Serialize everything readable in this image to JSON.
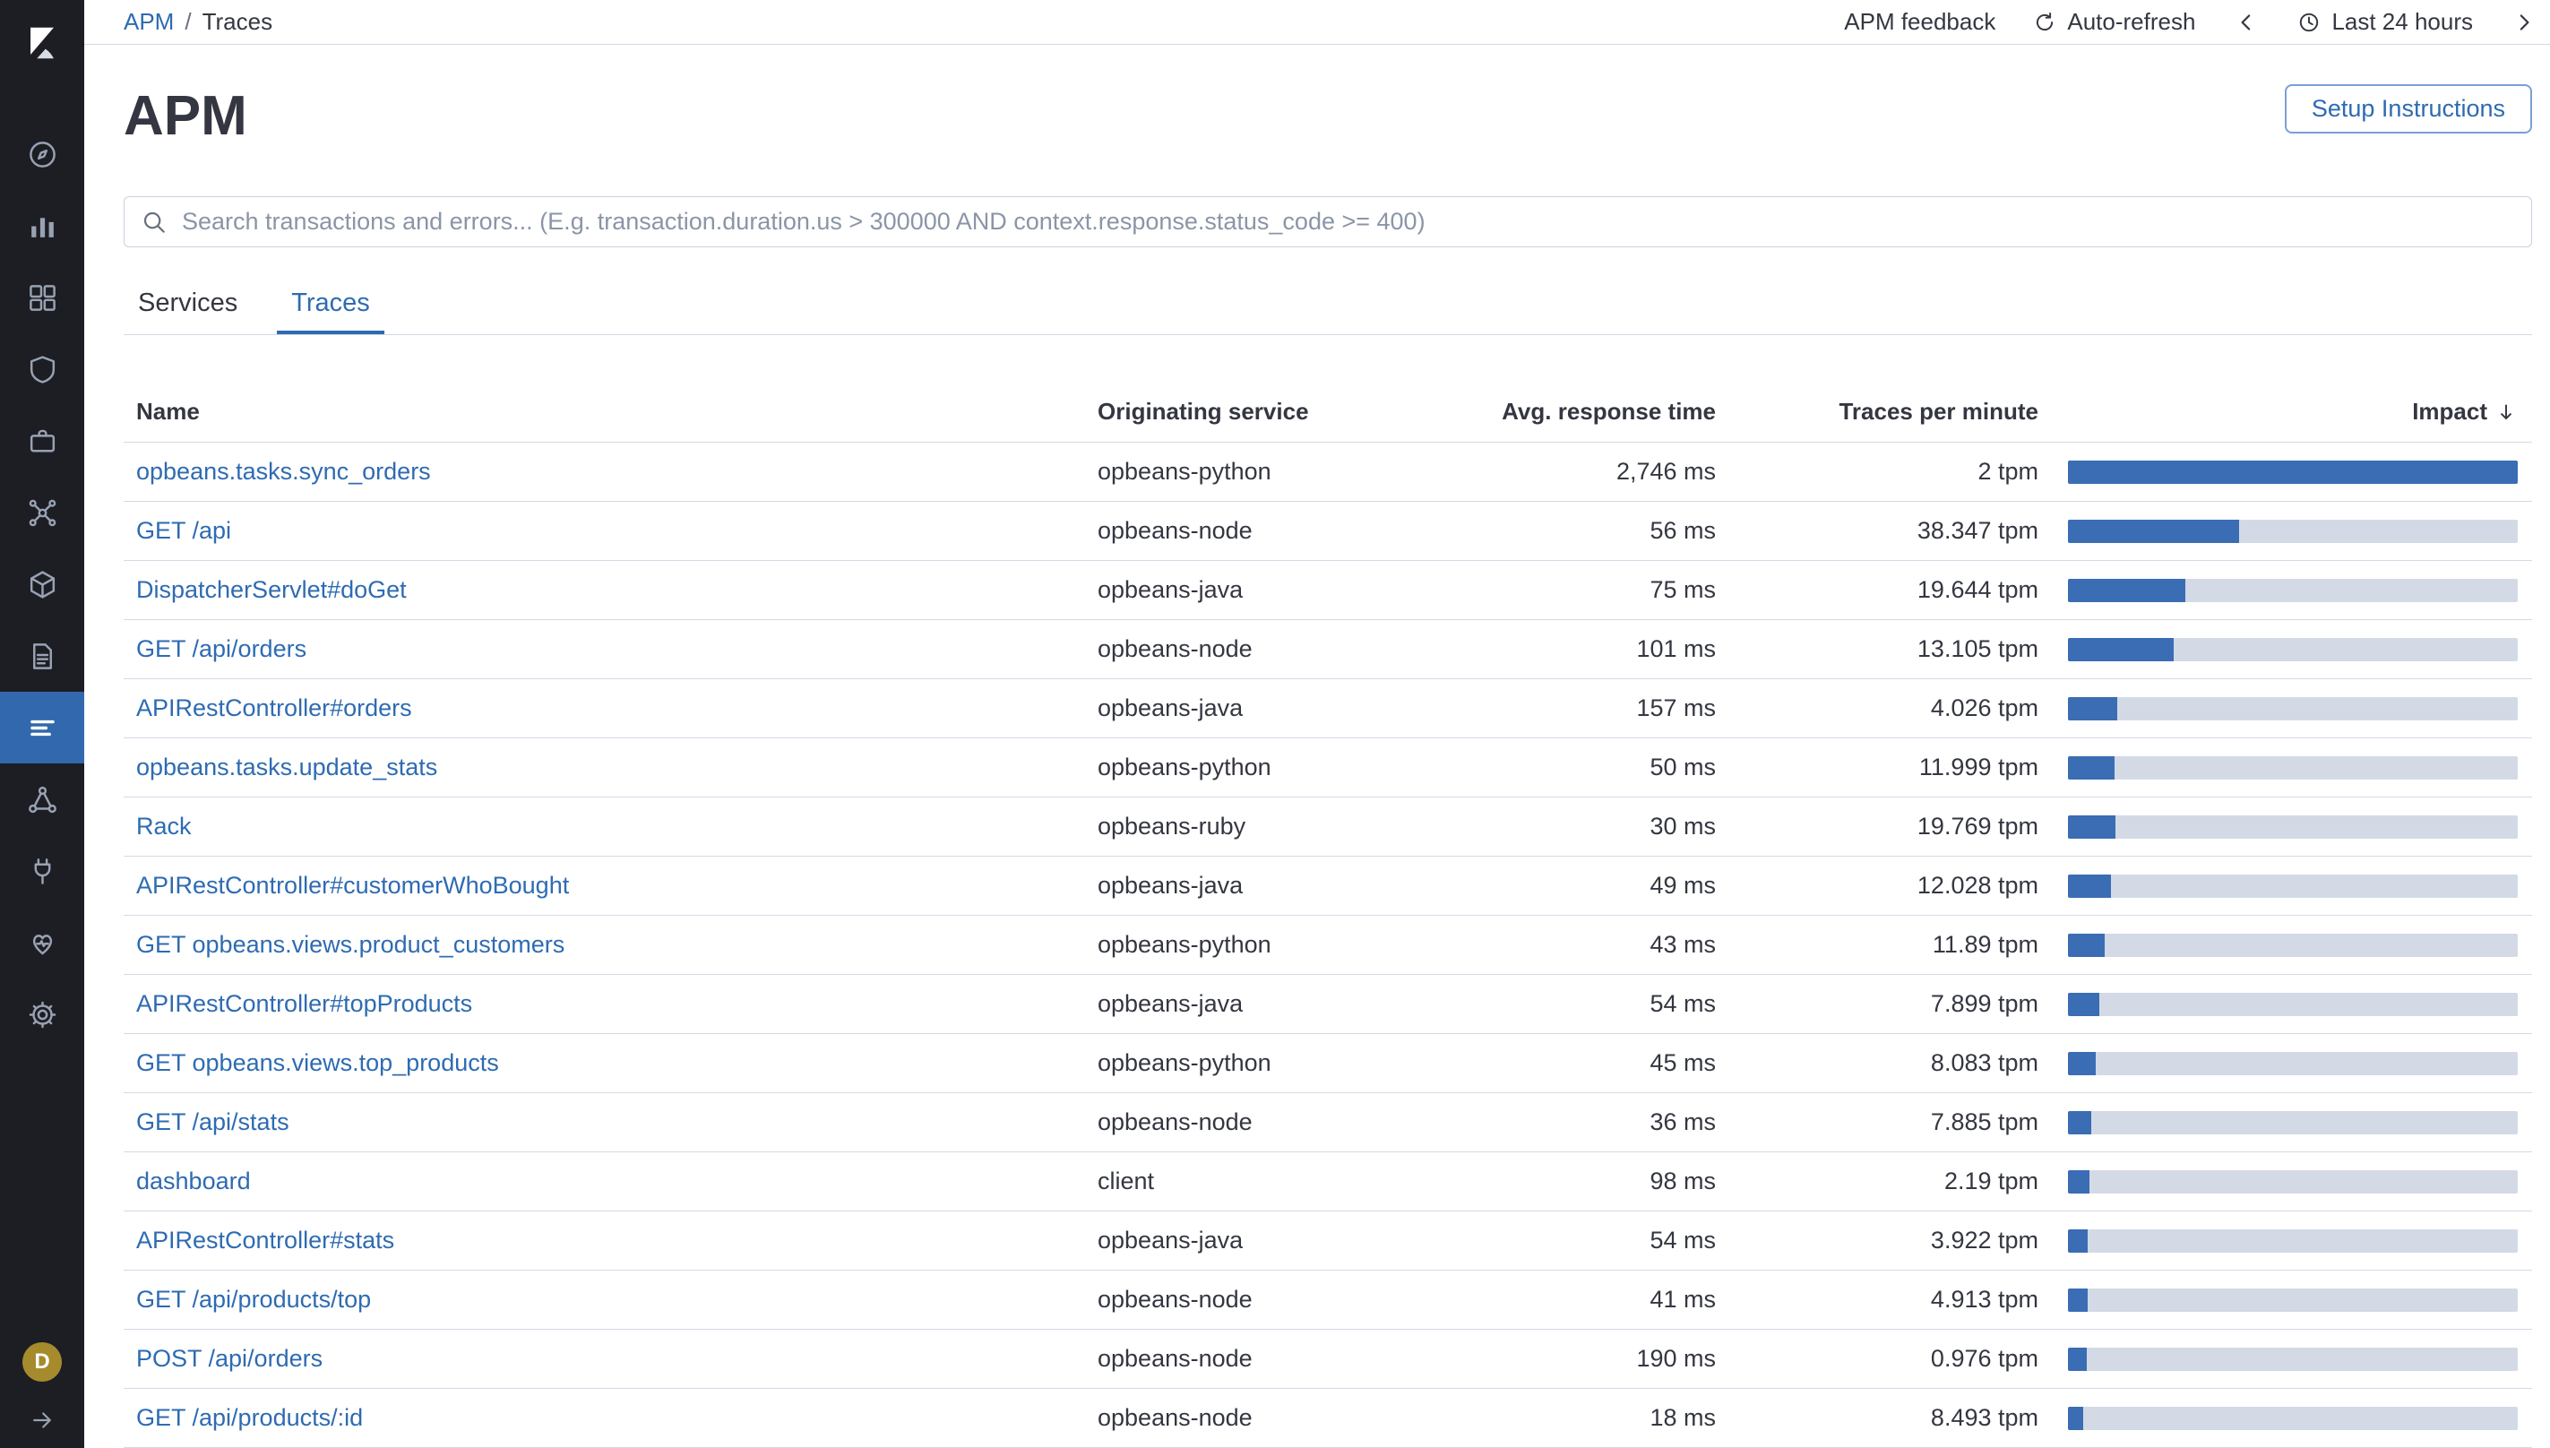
{
  "colors": {
    "accent": "#3a6db3",
    "link": "#2e6bb2",
    "sidebar_background": "#1d1e24",
    "nav_selected": "#3268ad",
    "bar_track": "#d3dae6",
    "border": "#d3dae6",
    "text": "#343741",
    "space_badge": "#a68b2c"
  },
  "sidebar": {
    "space_badge": "D",
    "items": [
      {
        "id": "discover",
        "selected": false
      },
      {
        "id": "visualize",
        "selected": false
      },
      {
        "id": "dashboard",
        "selected": false
      },
      {
        "id": "canvas",
        "selected": false
      },
      {
        "id": "maps",
        "selected": false
      },
      {
        "id": "machine-learning",
        "selected": false
      },
      {
        "id": "infrastructure",
        "selected": false
      },
      {
        "id": "logs",
        "selected": false
      },
      {
        "id": "apm",
        "selected": true
      },
      {
        "id": "graph",
        "selected": false
      },
      {
        "id": "uptime",
        "selected": false
      },
      {
        "id": "monitoring",
        "selected": false
      },
      {
        "id": "management",
        "selected": false
      }
    ]
  },
  "topbar": {
    "breadcrumb": {
      "link": "APM",
      "separator": "/",
      "current": "Traces"
    },
    "feedback_label": "APM feedback",
    "auto_refresh_label": "Auto-refresh",
    "time_range_label": "Last 24 hours"
  },
  "header": {
    "title": "APM",
    "setup_button_label": "Setup Instructions"
  },
  "search": {
    "placeholder": "Search transactions and errors... (E.g. transaction.duration.us > 300000 AND context.response.status_code >= 400)"
  },
  "tabs": [
    {
      "label": "Services",
      "active": false
    },
    {
      "label": "Traces",
      "active": true
    }
  ],
  "table": {
    "columns": [
      "Name",
      "Originating service",
      "Avg. response time",
      "Traces per minute",
      "Impact"
    ],
    "sort": {
      "column": "Impact",
      "direction": "descending"
    },
    "rows": [
      {
        "name": "opbeans.tasks.sync_orders",
        "service": "opbeans-python",
        "response": "2,746 ms",
        "tpm": "2 tpm",
        "impact": 100
      },
      {
        "name": "GET /api",
        "service": "opbeans-node",
        "response": "56 ms",
        "tpm": "38.347 tpm",
        "impact": 38
      },
      {
        "name": "DispatcherServlet#doGet",
        "service": "opbeans-java",
        "response": "75 ms",
        "tpm": "19.644 tpm",
        "impact": 26
      },
      {
        "name": "GET /api/orders",
        "service": "opbeans-node",
        "response": "101 ms",
        "tpm": "13.105 tpm",
        "impact": 23.5
      },
      {
        "name": "APIRestController#orders",
        "service": "opbeans-java",
        "response": "157 ms",
        "tpm": "4.026 tpm",
        "impact": 11
      },
      {
        "name": "opbeans.tasks.update_stats",
        "service": "opbeans-python",
        "response": "50 ms",
        "tpm": "11.999 tpm",
        "impact": 10.3
      },
      {
        "name": "Rack",
        "service": "opbeans-ruby",
        "response": "30 ms",
        "tpm": "19.769 tpm",
        "impact": 10.6
      },
      {
        "name": "APIRestController#customerWhoBought",
        "service": "opbeans-java",
        "response": "49 ms",
        "tpm": "12.028 tpm",
        "impact": 9.6
      },
      {
        "name": "GET opbeans.views.product_customers",
        "service": "opbeans-python",
        "response": "43 ms",
        "tpm": "11.89 tpm",
        "impact": 8.2
      },
      {
        "name": "APIRestController#topProducts",
        "service": "opbeans-java",
        "response": "54 ms",
        "tpm": "7.899 tpm",
        "impact": 7
      },
      {
        "name": "GET opbeans.views.top_products",
        "service": "opbeans-python",
        "response": "45 ms",
        "tpm": "8.083 tpm",
        "impact": 6.2
      },
      {
        "name": "GET /api/stats",
        "service": "opbeans-node",
        "response": "36 ms",
        "tpm": "7.885 tpm",
        "impact": 5.2
      },
      {
        "name": "dashboard",
        "service": "client",
        "response": "98 ms",
        "tpm": "2.19 tpm",
        "impact": 4.7
      },
      {
        "name": "APIRestController#stats",
        "service": "opbeans-java",
        "response": "54 ms",
        "tpm": "3.922 tpm",
        "impact": 4.4
      },
      {
        "name": "GET /api/products/top",
        "service": "opbeans-node",
        "response": "41 ms",
        "tpm": "4.913 tpm",
        "impact": 4.4
      },
      {
        "name": "POST /api/orders",
        "service": "opbeans-node",
        "response": "190 ms",
        "tpm": "0.976 tpm",
        "impact": 4.1
      },
      {
        "name": "GET /api/products/:id",
        "service": "opbeans-node",
        "response": "18 ms",
        "tpm": "8.493 tpm",
        "impact": 3.4
      }
    ]
  }
}
